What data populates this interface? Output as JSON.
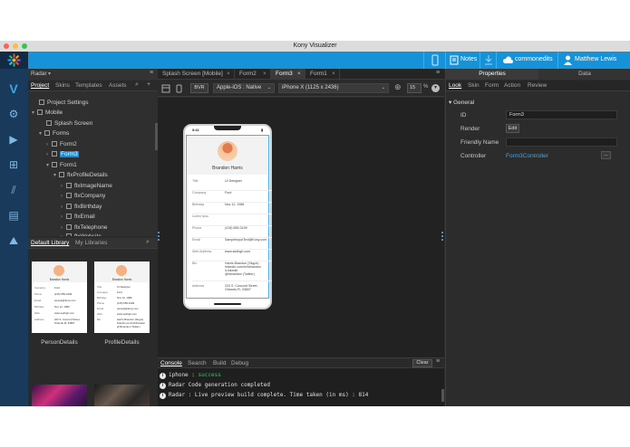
{
  "app": {
    "title": "Kony Visualizer"
  },
  "topbar": {
    "notes_label": "Notes",
    "workspace": "commonedits",
    "user": "Matthew Lewis"
  },
  "colors": {
    "accent": "#1692d8",
    "rail": "#1a3a5c",
    "selection": "#1e88d2"
  },
  "left_panel": {
    "scope_select": "Radar",
    "tabs": [
      "Project",
      "Skins",
      "Templates",
      "Assets"
    ],
    "tree": [
      {
        "label": "Project Settings"
      },
      {
        "label": "Mobile"
      },
      {
        "label": "Splash Screen"
      },
      {
        "label": "Forms"
      },
      {
        "label": "Form2"
      },
      {
        "label": "Form3"
      },
      {
        "label": "Form1"
      },
      {
        "label": "flxProfileDetails"
      },
      {
        "label": "flxImageName"
      },
      {
        "label": "flxCompany"
      },
      {
        "label": "flxBirthday"
      },
      {
        "label": "flxEmail"
      },
      {
        "label": "flxTelephone"
      },
      {
        "label": "flxWebsite"
      }
    ]
  },
  "library": {
    "tabs": [
      "Default Library",
      "My Libraries"
    ],
    "cards": [
      {
        "title": "PersonDetails"
      },
      {
        "title": "ProfileDetails"
      }
    ],
    "mini_name": "Brandon Harris",
    "mini_rows": [
      {
        "k": "Company",
        "v": "Ford"
      },
      {
        "k": "Phone",
        "v": "(415) 555-0199"
      },
      {
        "k": "Email",
        "v": "sample@kony.com"
      },
      {
        "k": "Birthday",
        "v": "Nov 12, 1986"
      },
      {
        "k": "Web",
        "v": "www.sedhgh.com"
      },
      {
        "k": "Address",
        "v": "223 S. Concord Street,\nOrlando,FL 33807"
      }
    ],
    "mini_rows2": [
      {
        "k": "Title",
        "v": "UI Designer"
      },
      {
        "k": "Company",
        "v": "Ford"
      },
      {
        "k": "Birthday",
        "v": "Nov 12, 1986"
      },
      {
        "k": "Phone",
        "v": "(415) 555-0199"
      },
      {
        "k": "Email",
        "v": "sample@kony.com"
      },
      {
        "k": "Web",
        "v": "www.sedhgh.com"
      },
      {
        "k": "Bio",
        "v": "Harris.Brandon (Skype)\nlinkedin.com/in/hbrandon\n@hbrandon (Twitter)"
      }
    ]
  },
  "editor": {
    "tabs": [
      {
        "label": "Splash Screen [Mobile]"
      },
      {
        "label": "Form2"
      },
      {
        "label": "Form3"
      },
      {
        "label": "Form1"
      }
    ],
    "toolbar": {
      "bvr": "BVR",
      "platform": "Apple-iOS : Native",
      "device": "iPhone X (1125 x 2436)",
      "zoom": "15",
      "zoom_unit": "%"
    }
  },
  "phone": {
    "time": "9:41",
    "name": "Brandon Harris",
    "rows": [
      {
        "k": "Title",
        "v": "UI Designer"
      },
      {
        "k": "Company",
        "v": "Ford"
      },
      {
        "k": "Birthday",
        "v": "Nov 12, 1986"
      },
      {
        "k": "Lorem Ipsu",
        "v": ""
      },
      {
        "k": "Phone",
        "v": "(415) 555-0199"
      },
      {
        "k": "Email",
        "v": "SampleInputText@Kony.com"
      },
      {
        "k": "Web Address",
        "v": "www.sedhgh.com"
      },
      {
        "k": "Bio",
        "v": "Harris.Brandon (Skype)\nlinkedin.com/in/hbrandon\n/Linkedin\n@hbrandon (Twitter)"
      },
      {
        "k": "Address",
        "v": "223 S. Concord Street,\nOrlando,FL 33807"
      }
    ]
  },
  "properties": {
    "tabs": [
      "Properties",
      "Data"
    ],
    "subtabs": [
      "Look",
      "Skin",
      "Form",
      "Action",
      "Review"
    ],
    "section": "General",
    "id_label": "ID",
    "id_value": "Form3",
    "render_label": "Render",
    "render_button": "Edit",
    "friendly_label": "Friendly Name",
    "friendly_value": "",
    "controller_label": "Controller",
    "controller_value": "Form3Controller",
    "more_button": "..."
  },
  "console": {
    "tabs": [
      "Console",
      "Search",
      "Build",
      "Debug"
    ],
    "clear_label": "Clear",
    "lines": [
      {
        "prefix": "iphone : ",
        "text": "success"
      },
      {
        "prefix": "",
        "text": "Radar Code generation completed"
      },
      {
        "prefix": "",
        "text": "Radar : Live preview build complete. Time taken (in ms) : 814"
      }
    ]
  }
}
